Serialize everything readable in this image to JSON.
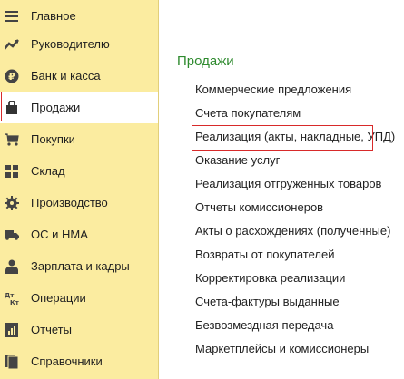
{
  "sidebar": {
    "items": [
      {
        "label": "Главное",
        "icon": "menu-lines-icon"
      },
      {
        "label": "Руководителю",
        "icon": "trend-chart-icon"
      },
      {
        "label": "Банк и касса",
        "icon": "ruble-coin-icon"
      },
      {
        "label": "Продажи",
        "icon": "shopping-bag-icon",
        "selected": true
      },
      {
        "label": "Покупки",
        "icon": "shopping-cart-icon"
      },
      {
        "label": "Склад",
        "icon": "warehouse-grid-icon"
      },
      {
        "label": "Производство",
        "icon": "gear-icon"
      },
      {
        "label": "ОС и НМА",
        "icon": "truck-icon"
      },
      {
        "label": "Зарплата и кадры",
        "icon": "person-icon"
      },
      {
        "label": "Операции",
        "icon": "dt-kt-icon"
      },
      {
        "label": "Отчеты",
        "icon": "report-icon"
      },
      {
        "label": "Справочники",
        "icon": "book-icon"
      }
    ]
  },
  "main": {
    "section_title": "Продажи",
    "links": [
      "Коммерческие предложения",
      "Счета покупателям",
      "Реализация (акты, накладные, УПД)",
      "Оказание услуг",
      "Реализация отгруженных товаров",
      "Отчеты комиссионеров",
      "Акты о расхождениях (полученные)",
      "Возвраты от покупателей",
      "Корректировка реализации",
      "Счета-фактуры выданные",
      "Безвозмездная передача",
      "Маркетплейсы и комиссионеры"
    ],
    "highlighted_link_index": 2
  },
  "colors": {
    "sidebar_bg": "#fbeca0",
    "section_title": "#2e8a2e",
    "highlight_border": "#d82a2a"
  }
}
